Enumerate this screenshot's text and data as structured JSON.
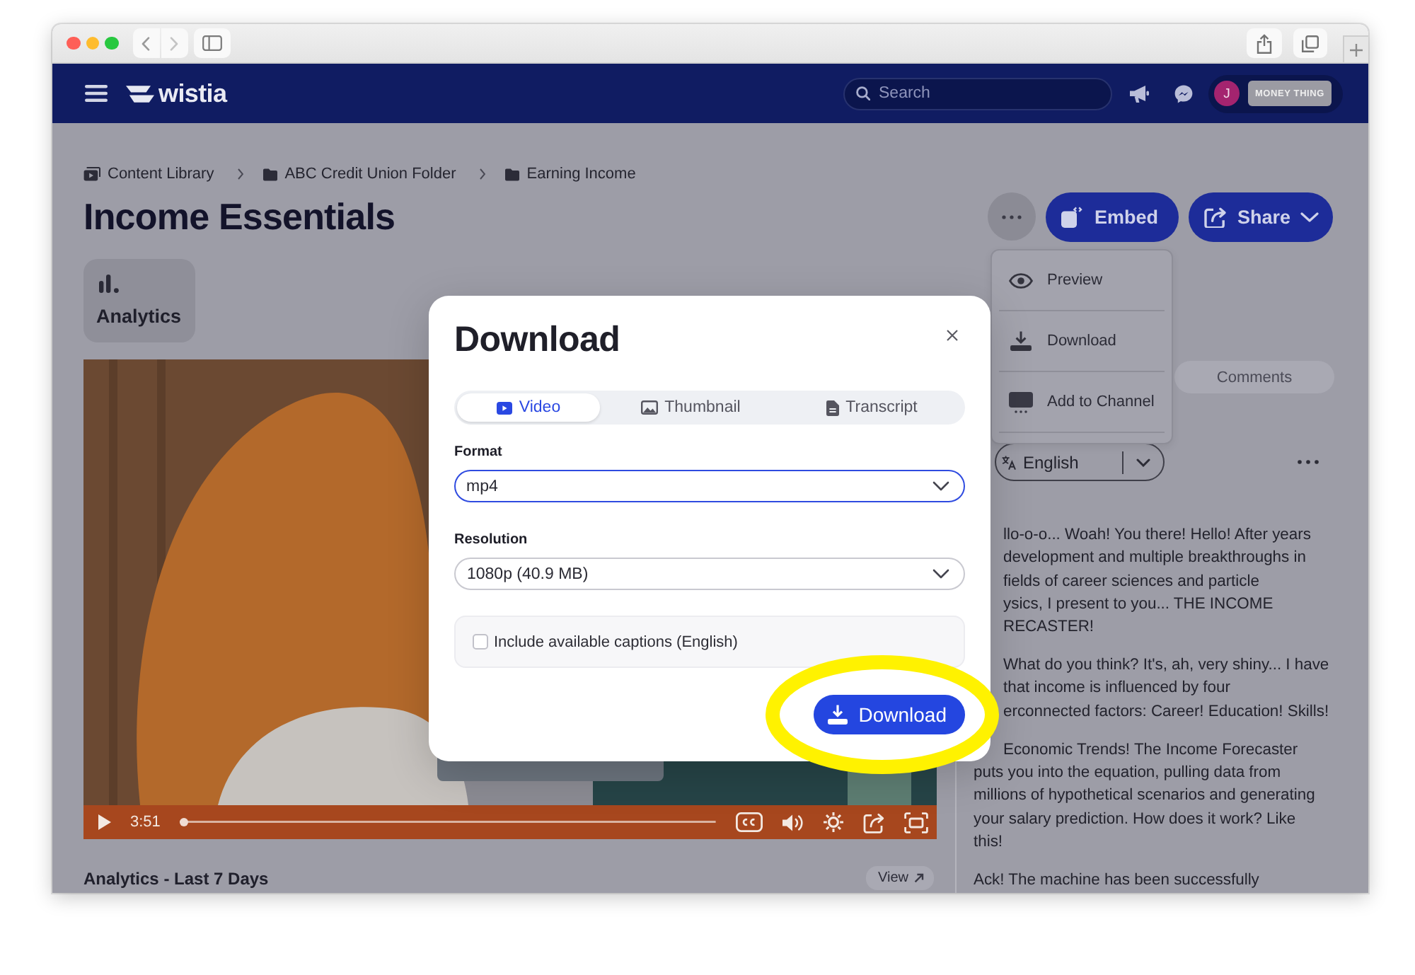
{
  "header": {
    "logo": "wistia",
    "search": {
      "placeholder": "Search"
    },
    "account": {
      "initial": "J",
      "brand": "MONEY THING"
    }
  },
  "breadcrumb": [
    {
      "label": "Content Library",
      "kind": "library"
    },
    {
      "label": "ABC Credit Union Folder",
      "kind": "folder"
    },
    {
      "label": "Earning Income",
      "kind": "folder"
    }
  ],
  "title": "Income Essentials",
  "actions": [
    {
      "label": "Embed",
      "kind": "embed"
    },
    {
      "label": "Share",
      "kind": "share"
    }
  ],
  "more_menu": {
    "expanded": true,
    "items": [
      {
        "label": "Preview",
        "kind": "preview"
      },
      {
        "label": "Download",
        "kind": "download"
      },
      {
        "label": "Add to Channel",
        "kind": "channel"
      }
    ]
  },
  "analytics_tile": {
    "label": "Analytics"
  },
  "video": {
    "time": "3:51",
    "level": 0
  },
  "analytics_section": {
    "title": "Analytics - Last 7 Days",
    "link": "View"
  },
  "side_tabs": [
    {
      "label": "Comments",
      "selected": false
    }
  ],
  "language": {
    "value": "English"
  },
  "transcript": [
    {
      "lines": [
        "llo-o-o... Woah! You there! Hello! After years",
        "development and multiple breakthroughs in",
        "fields of career sciences and particle",
        "ysics, I present to you... THE INCOME",
        "RECASTER!"
      ]
    },
    {
      "lines": [
        "What do you think? It's, ah, very shiny... I have",
        "that income is influenced by four",
        "erconnected factors: Career! Education! Skills!"
      ]
    },
    {
      "lines": [
        "Economic Trends! The Income Forecaster",
        "puts you into the equation, pulling data from",
        "millions of hypothetical scenarios and generating",
        "your salary prediction. How does it work? Like",
        "this!"
      ]
    },
    {
      "lines": [
        "Ack! The machine has been successfully"
      ]
    }
  ],
  "dialog": {
    "title": "Download",
    "tabs": [
      {
        "label": "Video",
        "kind": "video",
        "selected": true
      },
      {
        "label": "Thumbnail",
        "kind": "image",
        "selected": false
      },
      {
        "label": "Transcript",
        "kind": "document",
        "selected": false
      }
    ],
    "fields": [
      {
        "label": "Format",
        "value": "mp4",
        "focused": true
      },
      {
        "label": "Resolution",
        "value": "1080p (40.9 MB)",
        "focused": false
      }
    ],
    "captions": {
      "label": "Include available captions (English)",
      "checked": false
    },
    "button": "Download"
  },
  "highlight": {
    "kind": "ellipse"
  }
}
